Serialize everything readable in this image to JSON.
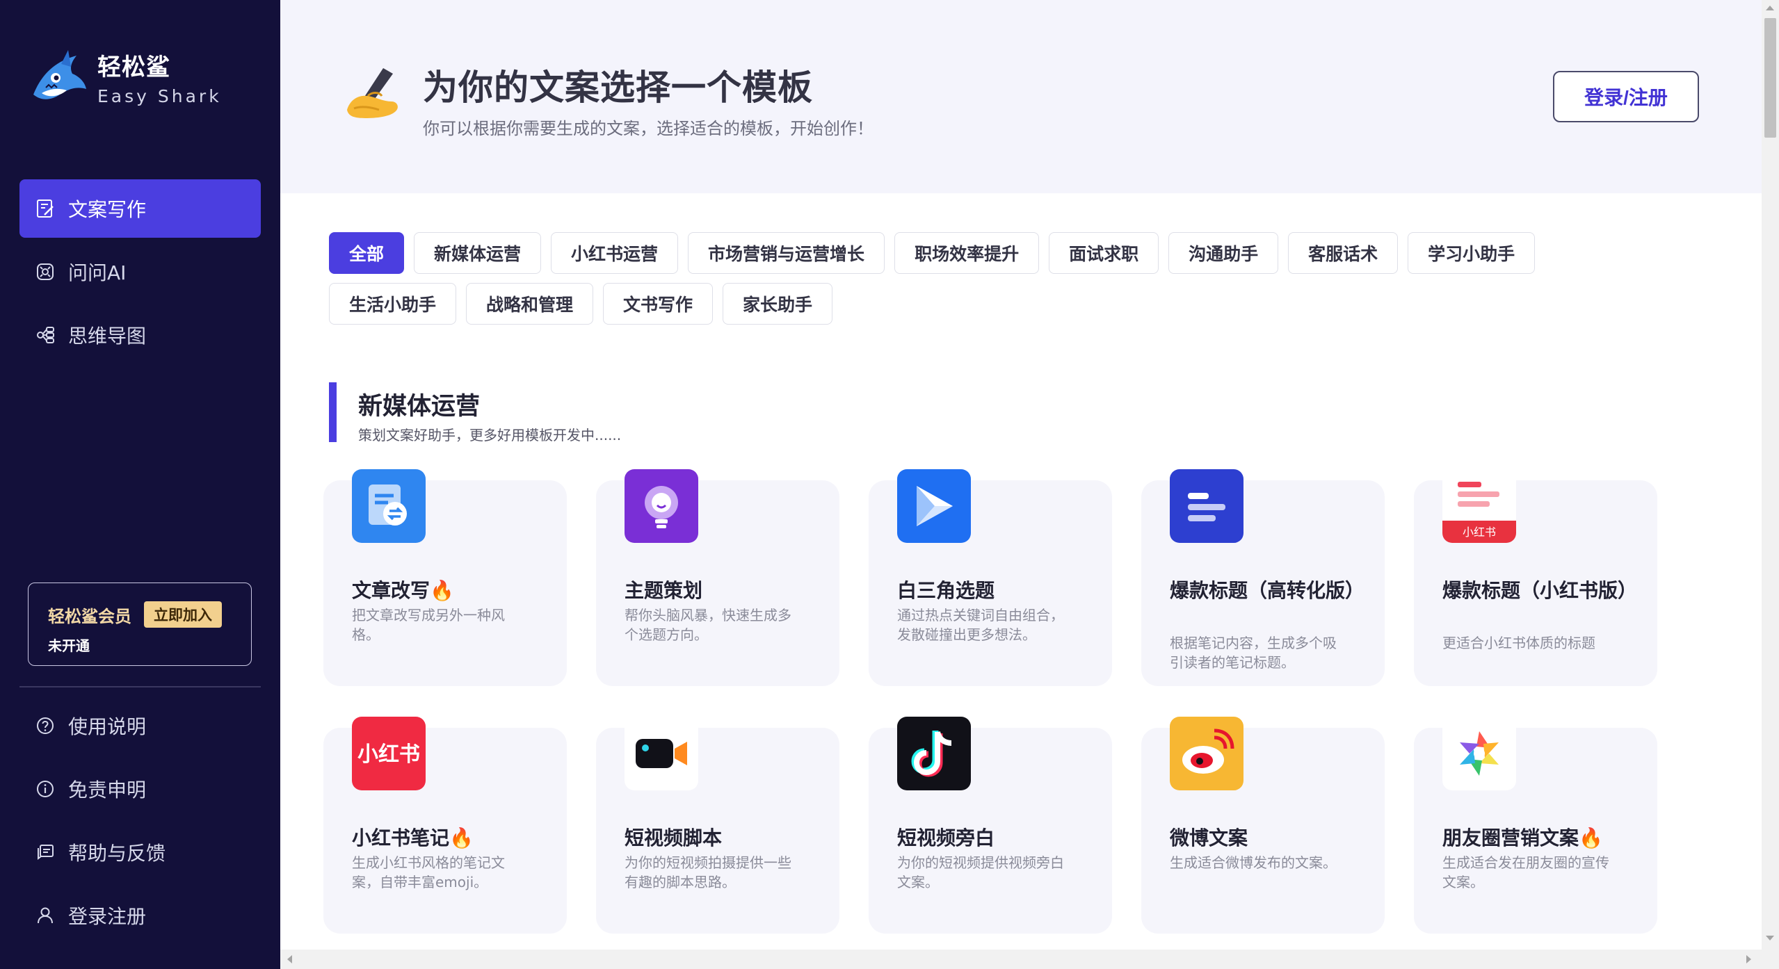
{
  "brand": {
    "name_cn": "轻松鲨",
    "name_en": "Easy Shark",
    "logo_icon": "shark-logo"
  },
  "sidebar": {
    "nav": [
      {
        "label": "文案写作",
        "icon": "edit-doc-icon",
        "active": true
      },
      {
        "label": "问问AI",
        "icon": "ai-chat-icon",
        "active": false
      },
      {
        "label": "思维导图",
        "icon": "mindmap-icon",
        "active": false
      }
    ],
    "member": {
      "title": "轻松鲨会员",
      "button": "立即加入",
      "status": "未开通"
    },
    "bottom": [
      {
        "label": "使用说明",
        "icon": "question-circle-icon"
      },
      {
        "label": "免责申明",
        "icon": "info-circle-icon"
      },
      {
        "label": "帮助与反馈",
        "icon": "feedback-icon"
      },
      {
        "label": "登录注册",
        "icon": "user-icon"
      }
    ]
  },
  "header": {
    "title": "为你的文案选择一个模板",
    "subtitle": "你可以根据你需要生成的文案，选择适合的模板，开始创作！",
    "login_button": "登录/注册",
    "icon": "writing-hand-icon"
  },
  "filters": [
    "全部",
    "新媒体运营",
    "小红书运营",
    "市场营销与运营增长",
    "职场效率提升",
    "面试求职",
    "沟通助手",
    "客服话术",
    "学习小助手",
    "生活小助手",
    "战略和管理",
    "文书写作",
    "家长助手"
  ],
  "active_filter": "全部",
  "section": {
    "title": "新媒体运营",
    "subtitle": "策划文案好助手，更多好用模板开发中......"
  },
  "cards": [
    {
      "title": "文章改写🔥",
      "desc": "把文章改写成另外一种风格。",
      "icon": "article-rewrite-icon"
    },
    {
      "title": "主题策划",
      "desc": "帮你头脑风暴，快速生成多个选题方向。",
      "icon": "lightbulb-icon"
    },
    {
      "title": "白三角选题",
      "desc": "通过热点关键词自由组合，发散碰撞出更多想法。",
      "icon": "triangle-play-icon"
    },
    {
      "title": "爆款标题（高转化版）",
      "desc": "根据笔记内容，生成多个吸引读者的笔记标题。",
      "icon": "title-lines-icon"
    },
    {
      "title": "爆款标题（小红书版）",
      "desc": "更适合小红书体质的标题",
      "icon": "xiaohongshu-doc-icon",
      "badge": "小红书"
    },
    {
      "title": "小红书笔记🔥",
      "desc": "生成小红书风格的笔记文案，自带丰富emoji。",
      "icon": "xiaohongshu-logo-icon",
      "badge": "小红书"
    },
    {
      "title": "短视频脚本",
      "desc": "为你的短视频拍摄提供一些有趣的脚本思路。",
      "icon": "video-camera-icon"
    },
    {
      "title": "短视频旁白",
      "desc": "为你的短视频提供视频旁白文案。",
      "icon": "tiktok-icon"
    },
    {
      "title": "微博文案",
      "desc": "生成适合微博发布的文案。",
      "icon": "weibo-icon"
    },
    {
      "title": "朋友圈营销文案🔥",
      "desc": "生成适合发在朋友圈的宣传文案。",
      "icon": "moments-aperture-icon"
    }
  ]
}
